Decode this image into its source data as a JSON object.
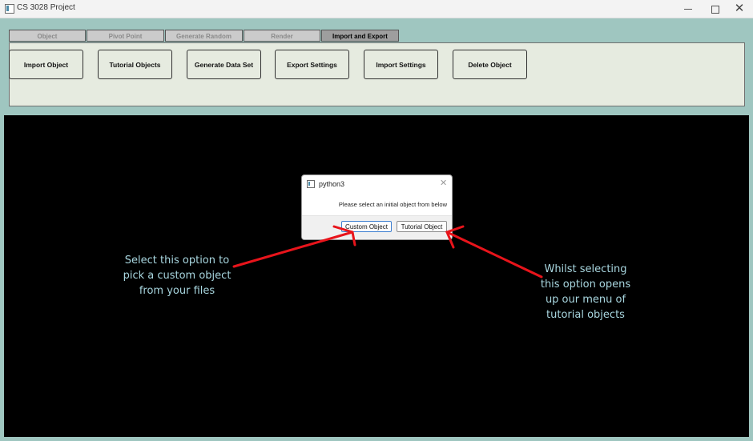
{
  "window": {
    "title": "CS 3028 Project",
    "controls": {
      "minimize": "—",
      "maximize": "☐",
      "close": "✕"
    }
  },
  "tabs": [
    {
      "label": "Object",
      "active": false
    },
    {
      "label": "Pivot Point",
      "active": false
    },
    {
      "label": "Generate Random",
      "active": false
    },
    {
      "label": "Render",
      "active": false
    },
    {
      "label": "Import and Export",
      "active": true
    }
  ],
  "toolbar": {
    "buttons": [
      "Import Object",
      "Tutorial Objects",
      "Generate Data Set",
      "Export Settings",
      "Import Settings",
      "Delete Object"
    ]
  },
  "dialog": {
    "title": "python3",
    "message": "Please select an initial object from below",
    "buttons": {
      "custom": "Custom Object",
      "tutorial": "Tutorial Object"
    }
  },
  "annotations": {
    "left": [
      "Select this option to",
      "pick a custom object",
      "from your files"
    ],
    "right": [
      "Whilst selecting",
      "this option opens",
      "up our menu of",
      "tutorial objects"
    ]
  },
  "colors": {
    "background": "#9fc6c0",
    "canvas": "#000000",
    "annotation_text": "#a8d6df",
    "arrow": "#e8141b"
  }
}
